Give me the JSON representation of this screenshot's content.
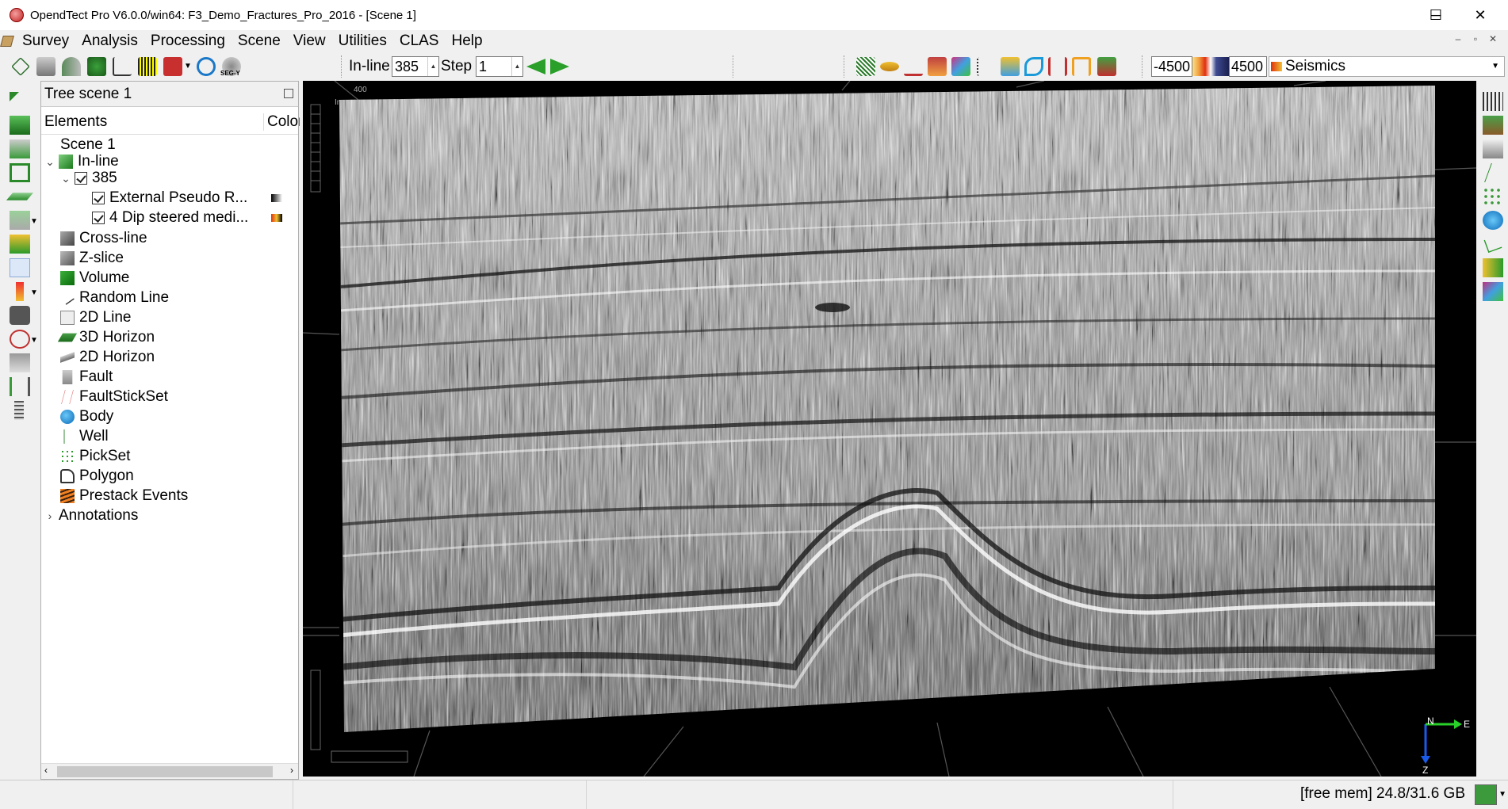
{
  "window": {
    "title": "OpendTect Pro V6.0.0/win64: F3_Demo_Fractures_Pro_2016 - [Scene 1]",
    "controls": {
      "minimize": "─",
      "maximize": "☐",
      "close": "✕"
    }
  },
  "menubar": {
    "items": [
      "Survey",
      "Analysis",
      "Processing",
      "Scene",
      "View",
      "Utilities",
      "CLAS",
      "Help"
    ],
    "mdi_controls": [
      "–",
      "▫",
      "✕"
    ]
  },
  "toolbar": {
    "inline_label": "In-line",
    "inline_value": "385",
    "step_label": "Step",
    "step_value": "1",
    "colorbar_min": "-4500",
    "colorbar_max": "4500",
    "attribute": "Seismics",
    "segy_label": "SEG-Y"
  },
  "tree": {
    "title": "Tree scene 1",
    "col_elements": "Elements",
    "col_color": "Color",
    "items": [
      {
        "label": "Scene 1"
      },
      {
        "label": "In-line"
      },
      {
        "label": "385"
      },
      {
        "label": "External Pseudo R..."
      },
      {
        "label": "4 Dip steered medi..."
      },
      {
        "label": "Cross-line"
      },
      {
        "label": "Z-slice"
      },
      {
        "label": "Volume"
      },
      {
        "label": "Random Line"
      },
      {
        "label": "2D Line"
      },
      {
        "label": "3D Horizon"
      },
      {
        "label": "2D Horizon"
      },
      {
        "label": "Fault"
      },
      {
        "label": "FaultStickSet"
      },
      {
        "label": "Body"
      },
      {
        "label": "Well"
      },
      {
        "label": "PickSet"
      },
      {
        "label": "Polygon"
      },
      {
        "label": "Prestack Events"
      },
      {
        "label": "Annotations"
      }
    ]
  },
  "scene": {
    "axis_label_top": "400",
    "axis_label_side": "In",
    "compass": {
      "north": "N",
      "east": "E",
      "down": "Z"
    }
  },
  "status": {
    "free_mem": "[free mem] 24.8/31.6 GB"
  },
  "colors": {
    "accent_green": "#2aa02a",
    "scene_bg": "#000000"
  }
}
